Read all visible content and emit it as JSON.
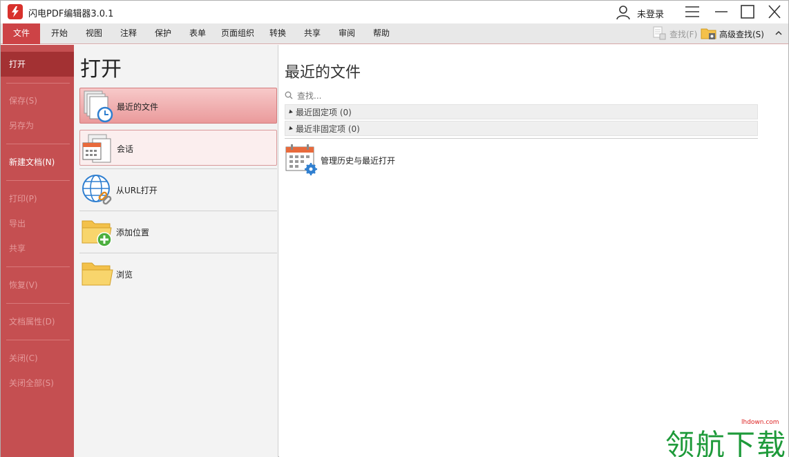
{
  "app": {
    "title": "闪电PDF编辑器3.0.1",
    "login": "未登录"
  },
  "ribbon": {
    "tabs": [
      "文件",
      "开始",
      "视图",
      "注释",
      "保护",
      "表单",
      "页面组织",
      "转换",
      "共享",
      "审阅",
      "帮助"
    ],
    "search": "查找(F)",
    "advanced_search": "高级查找(S)"
  },
  "nav": {
    "open": "打开",
    "save": "保存(S)",
    "save_as": "另存为",
    "new_doc": "新建文档(N)",
    "print": "打印(P)",
    "export": "导出",
    "share": "共享",
    "restore": "恢复(V)",
    "properties": "文档属性(D)",
    "close": "关闭(C)",
    "close_all": "关闭全部(S)"
  },
  "open_panel": {
    "heading": "打开",
    "items": [
      "最近的文件",
      "会话",
      "从URL打开",
      "添加位置",
      "浏览"
    ]
  },
  "recent": {
    "heading": "最近的文件",
    "search_placeholder": "查找...",
    "pinned": "最近固定项 (0)",
    "unpinned": "最近非固定项 (0)",
    "manage": "管理历史与最近打开"
  },
  "watermark": {
    "text": "领航下载",
    "url": "lhdown.com"
  },
  "colors": {
    "accent": "#cd4346",
    "nav_bg": "#c54f51",
    "nav_active": "#a33133"
  }
}
